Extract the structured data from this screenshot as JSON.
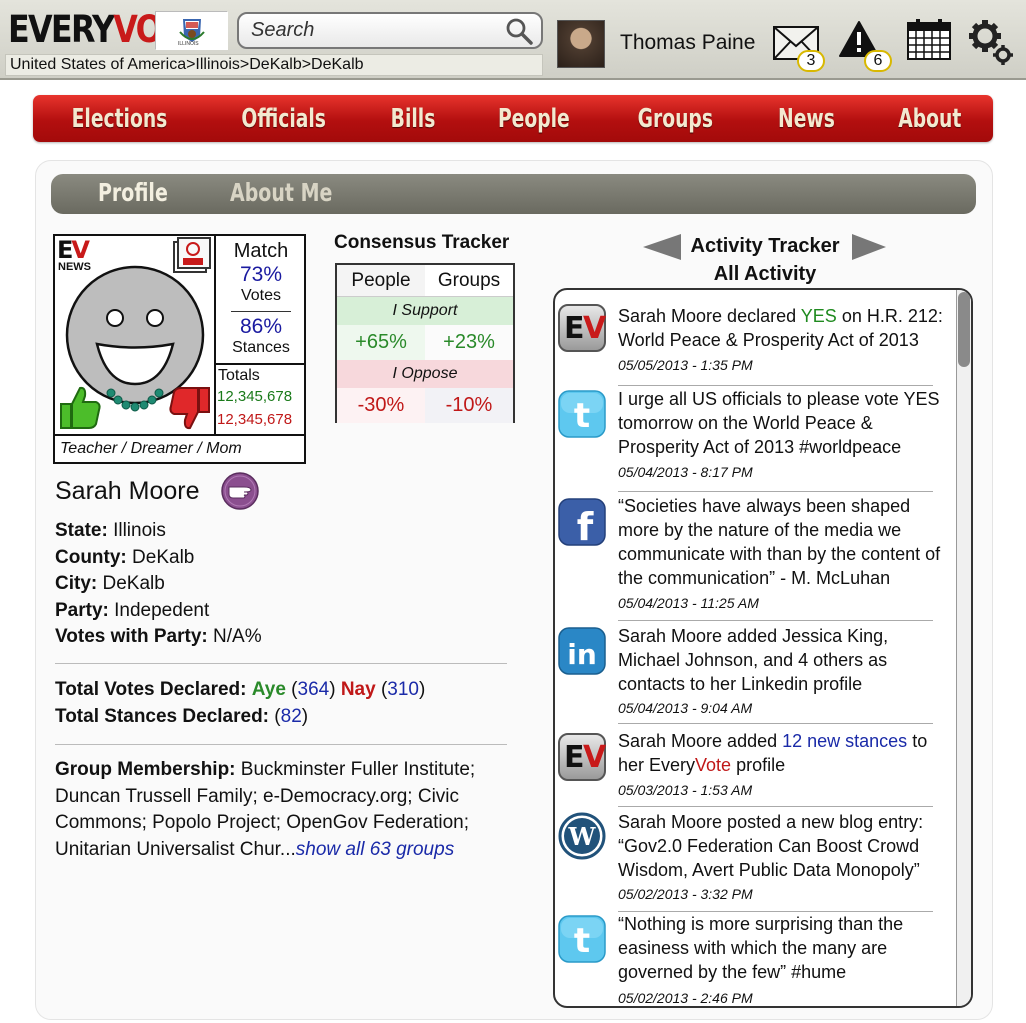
{
  "header": {
    "logo_every": "EVERY",
    "logo_vote": "VOTE",
    "flag_label": "ILLINOIS",
    "search_placeholder": "Search",
    "breadcrumb": "United States of America>Illinois>DeKalb>DeKalb",
    "user_name": "Thomas Paine",
    "messages_count": "3",
    "alerts_count": "6"
  },
  "nav": [
    "Elections",
    "Officials",
    "Bills",
    "People",
    "Groups",
    "News",
    "About"
  ],
  "subtabs": {
    "profile": "Profile",
    "about_me": "About Me"
  },
  "card": {
    "news_badge": "NEWS",
    "match_title": "Match",
    "votes_pct": "73%",
    "votes_label": "Votes",
    "stances_pct": "86%",
    "stances_label": "Stances",
    "totals_label": "Totals",
    "totals_up": "12,345,678",
    "totals_down": "12,345,678",
    "tagline": "Teacher / Dreamer / Mom"
  },
  "profile": {
    "name": "Sarah Moore",
    "state_label": "State:",
    "state": "Illinois",
    "county_label": "County:",
    "county": "DeKalb",
    "city_label": "City:",
    "city": "DeKalb",
    "party_label": "Party:",
    "party": "Indepedent",
    "party_votes_label": "Votes with Party:",
    "party_votes": "N/A%",
    "total_votes_label": "Total Votes Declared:",
    "aye_label": "Aye",
    "aye_count": "364",
    "nay_label": "Nay",
    "nay_count": "310",
    "total_stances_label": "Total Stances Declared:",
    "stances_count": "82",
    "groups_label": "Group Membership:",
    "groups_text": "Buckminster Fuller Institute; Duncan Trussell Family; e-Democracy.org; Civic Commons; Popolo Project; OpenGov Federation; Unitarian Universalist Chur...",
    "groups_link": "show all 63 groups"
  },
  "consensus": {
    "title": "Consensus Tracker",
    "col_people": "People",
    "col_groups": "Groups",
    "support_label": "I Support",
    "support_people": "+65%",
    "support_groups": "+23%",
    "oppose_label": "I Oppose",
    "oppose_people": "-30%",
    "oppose_groups": "-10%"
  },
  "activity": {
    "title": "Activity Tracker",
    "filter": "All Activity",
    "items": [
      {
        "icon": "everyvote-icon",
        "pre": "Sarah Moore declared ",
        "hl": "YES",
        "post": " on H.R. 212: World Peace & Prosperity Act of 2013",
        "time": "05/05/2013 - 1:35 PM"
      },
      {
        "icon": "twitter-icon",
        "text": "I urge all US officials to please vote YES tomorrow on the World Peace & Prosperity Act of 2013 #worldpeace",
        "time": "05/04/2013 - 8:17 PM"
      },
      {
        "icon": "facebook-icon",
        "text": "“Societies have always been shaped more by the nature of the media we communicate with than by the content of the communication” - M. McLuhan",
        "time": "05/04/2013 - 11:25 AM"
      },
      {
        "icon": "linkedin-icon",
        "text": "Sarah Moore added Jessica King, Michael Johnson, and 4 others as contacts to her Linkedin profile",
        "time": "05/04/2013 - 9:04 AM"
      },
      {
        "icon": "everyvote-icon",
        "pre": "Sarah Moore added ",
        "hl": "12 new stances",
        "mid": " to her Every",
        "hl2": "Vote",
        "post": " profile",
        "time": "05/03/2013 - 1:53 AM"
      },
      {
        "icon": "wordpress-icon",
        "text": "Sarah Moore posted a new blog entry: “Gov2.0 Federation Can Boost Crowd Wisdom, Avert Public Data Monopoly”",
        "time": "05/02/2013 - 3:32 PM"
      },
      {
        "icon": "twitter-icon",
        "text": "“Nothing is more surprising than the easiness with which the many are governed by the few” #hume",
        "time": "05/02/2013 - 2:46 PM"
      }
    ]
  }
}
